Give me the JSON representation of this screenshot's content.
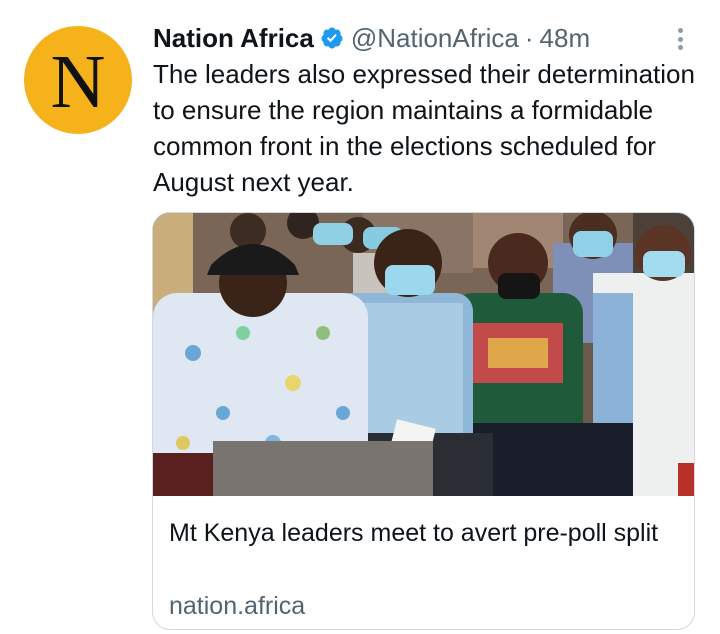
{
  "author": {
    "name": "Nation Africa",
    "handle": "@NationAfrica",
    "separator": "·",
    "time": "48m",
    "avatar_letter": "N",
    "avatar_color": "#f6b21a",
    "verified_color": "#1d9bf0"
  },
  "tweet": {
    "text": "The leaders also expressed their determination to ensure the region maintains a formidable common front in the elections scheduled for August next year."
  },
  "link_card": {
    "title": "Mt Kenya leaders meet to avert pre-poll split",
    "domain": "nation.africa"
  },
  "icons": {
    "verified": "verified-badge-icon",
    "more": "more-options-icon"
  }
}
